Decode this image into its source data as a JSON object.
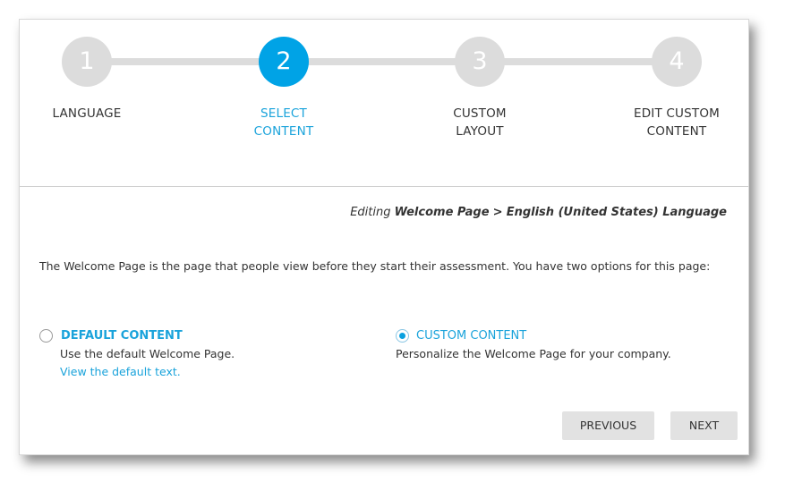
{
  "steps": [
    {
      "number": "1",
      "label_line1": "LANGUAGE",
      "label_line2": "",
      "active": false
    },
    {
      "number": "2",
      "label_line1": "SELECT",
      "label_line2": "CONTENT",
      "active": true
    },
    {
      "number": "3",
      "label_line1": "CUSTOM",
      "label_line2": "LAYOUT",
      "active": false
    },
    {
      "number": "4",
      "label_line1": "EDIT CUSTOM",
      "label_line2": "CONTENT",
      "active": false
    }
  ],
  "editing": {
    "prefix": "Editing",
    "page": "Welcome Page",
    "separator": ">",
    "language": "English (United States) Language"
  },
  "intro_text": "The Welcome Page is the page that people view before they start their assessment. You have two options for this page:",
  "options": {
    "default": {
      "title": "DEFAULT CONTENT",
      "description": "Use the default Welcome Page.",
      "link": "View the default text.",
      "selected": false
    },
    "custom": {
      "title": "CUSTOM CONTENT",
      "description": "Personalize the Welcome Page for your company.",
      "selected": true
    }
  },
  "buttons": {
    "previous": "PREVIOUS",
    "next": "NEXT"
  },
  "colors": {
    "accent": "#00a3e6",
    "inactive_step": "#dcdcdc",
    "button_bg": "#e2e2e2"
  }
}
